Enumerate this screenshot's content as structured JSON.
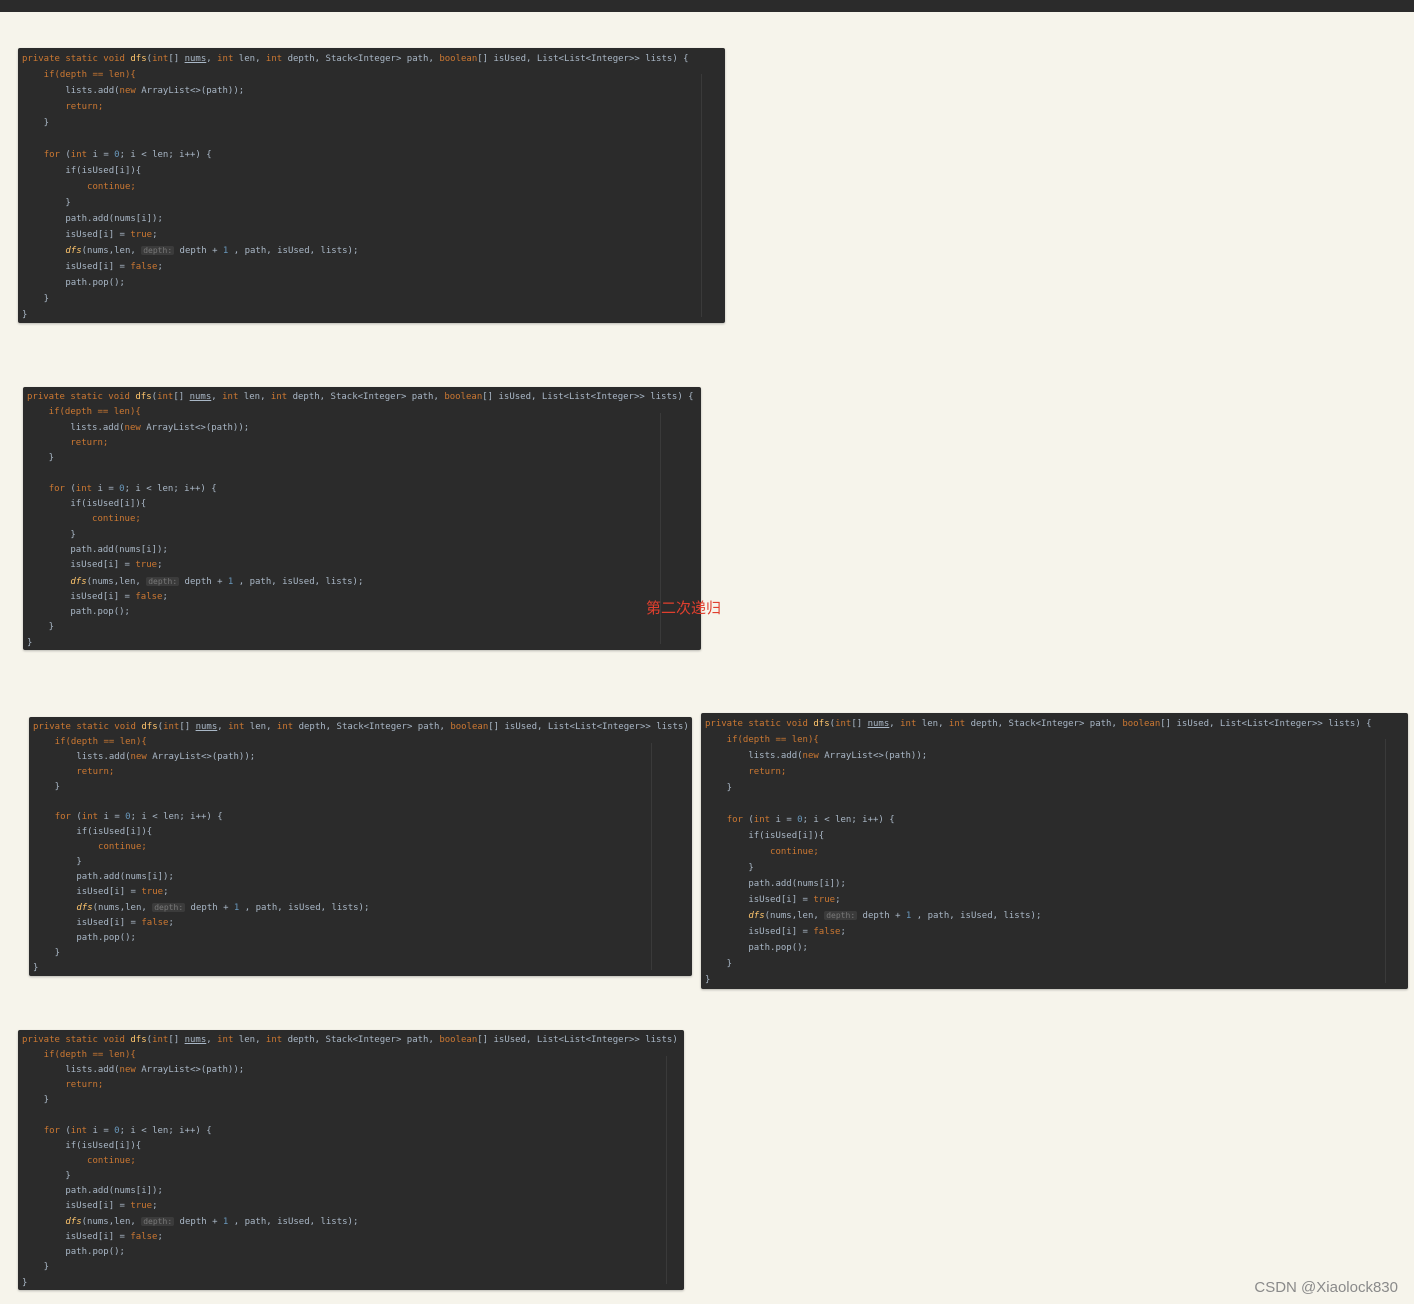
{
  "code": {
    "l_sig_a": "private static void ",
    "l_sig_fn": "dfs",
    "l_sig_b": "(",
    "l_sig_int1": "int",
    "l_sig_c": "[] ",
    "l_sig_nums": "nums",
    "l_sig_d": ", ",
    "l_sig_int2": "int",
    "l_sig_e": " len, ",
    "l_sig_int3": "int",
    "l_sig_f": " depth, Stack<Integer> path, ",
    "l_sig_bool": "boolean",
    "l_sig_g": "[] isUsed, List<List<Integer>> lists) {",
    "l_if_a": "    if(depth == len){",
    "l_add_a": "        lists.add(",
    "l_add_new": "new",
    "l_add_b": " ArrayList<>(path));",
    "l_return": "return;",
    "l_close1": "    }",
    "l_for_kw": "for",
    "l_for_a": " (",
    "l_for_int": "int",
    "l_for_b": " i = ",
    "l_for_zero": "0",
    "l_for_c": "; i < len; i++) {",
    "l_ifused": "        if(isUsed[i]){",
    "l_continue": "continue;",
    "l_close2": "        }",
    "l_pathadd": "        path.add(nums[i]);",
    "l_set_true_a": "        isUsed[i] = ",
    "l_true": "true",
    "l_semi": ";",
    "l_dfs_fn": "dfs",
    "l_dfs_a": "(nums,len, ",
    "l_dfs_hint": "depth:",
    "l_dfs_b": " depth + ",
    "l_dfs_one": "1",
    "l_dfs_c": " , path, isUsed, lists);",
    "l_set_false_a": "        isUsed[i] = ",
    "l_false": "false",
    "l_pop": "        path.pop();",
    "l_close3": "    }",
    "l_close4": "}"
  },
  "labels": {
    "second_recursion": "第二次递归"
  },
  "watermark": "CSDN @Xiaolock830"
}
